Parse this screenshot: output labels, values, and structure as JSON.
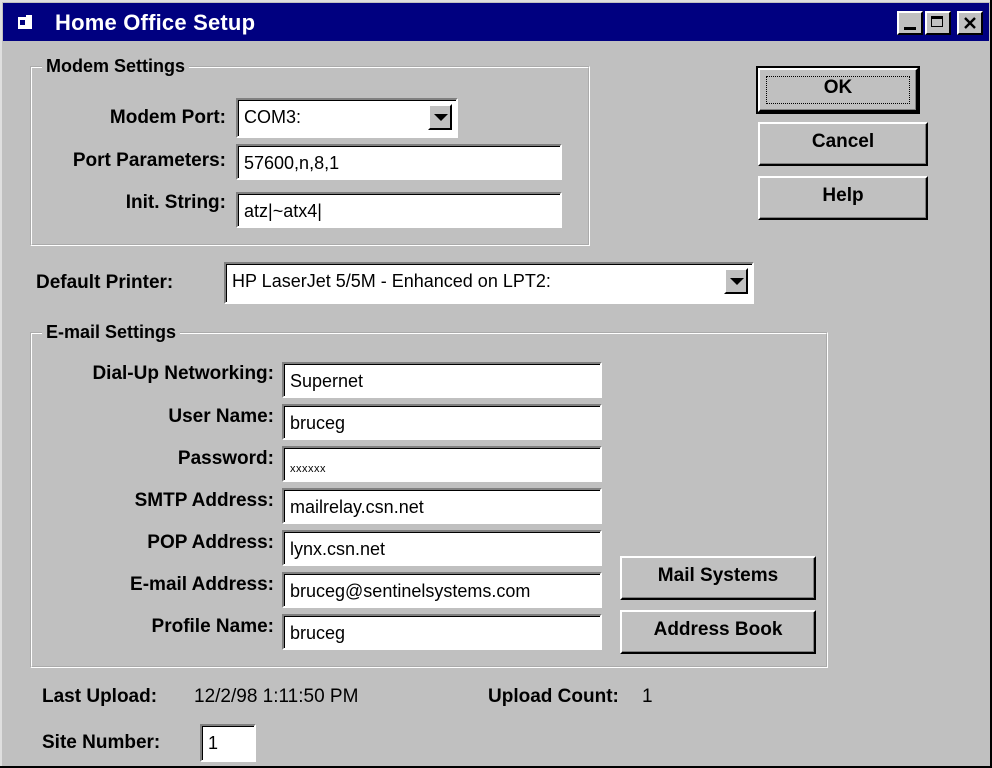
{
  "window": {
    "title": "Home Office Setup",
    "controls": {
      "minimize": "minimize-icon",
      "maximize": "maximize-icon",
      "close": "close-icon"
    }
  },
  "modem": {
    "group_title": "Modem Settings",
    "port_label": "Modem Port:",
    "port_value": "COM3:",
    "params_label": "Port Parameters:",
    "params_value": "57600,n,8,1",
    "init_label": "Init. String:",
    "init_value": "atz|~atx4|"
  },
  "buttons": {
    "ok": "OK",
    "cancel": "Cancel",
    "help": "Help",
    "mail_systems": "Mail Systems",
    "address_book": "Address Book"
  },
  "printer": {
    "label": "Default Printer:",
    "value": "HP LaserJet 5/5M - Enhanced on LPT2:"
  },
  "email": {
    "group_title": "E-mail Settings",
    "dialup_label": "Dial-Up Networking:",
    "dialup_value": "Supernet",
    "user_label": "User Name:",
    "user_value": "bruceg",
    "password_label": "Password:",
    "password_value": "xxxxxx",
    "smtp_label": "SMTP Address:",
    "smtp_value": "mailrelay.csn.net",
    "pop_label": "POP Address:",
    "pop_value": "lynx.csn.net",
    "email_label": "E-mail Address:",
    "email_value": "bruceg@sentinelsystems.com",
    "profile_label": "Profile Name:",
    "profile_value": "bruceg"
  },
  "status": {
    "last_upload_label": "Last Upload:",
    "last_upload_value": "12/2/98 1:11:50 PM",
    "upload_count_label": "Upload Count:",
    "upload_count_value": "1",
    "site_number_label": "Site Number:",
    "site_number_value": "1"
  },
  "colors": {
    "title_bar": "#000080",
    "face": "#c0c0c0",
    "field": "#ffffff"
  }
}
